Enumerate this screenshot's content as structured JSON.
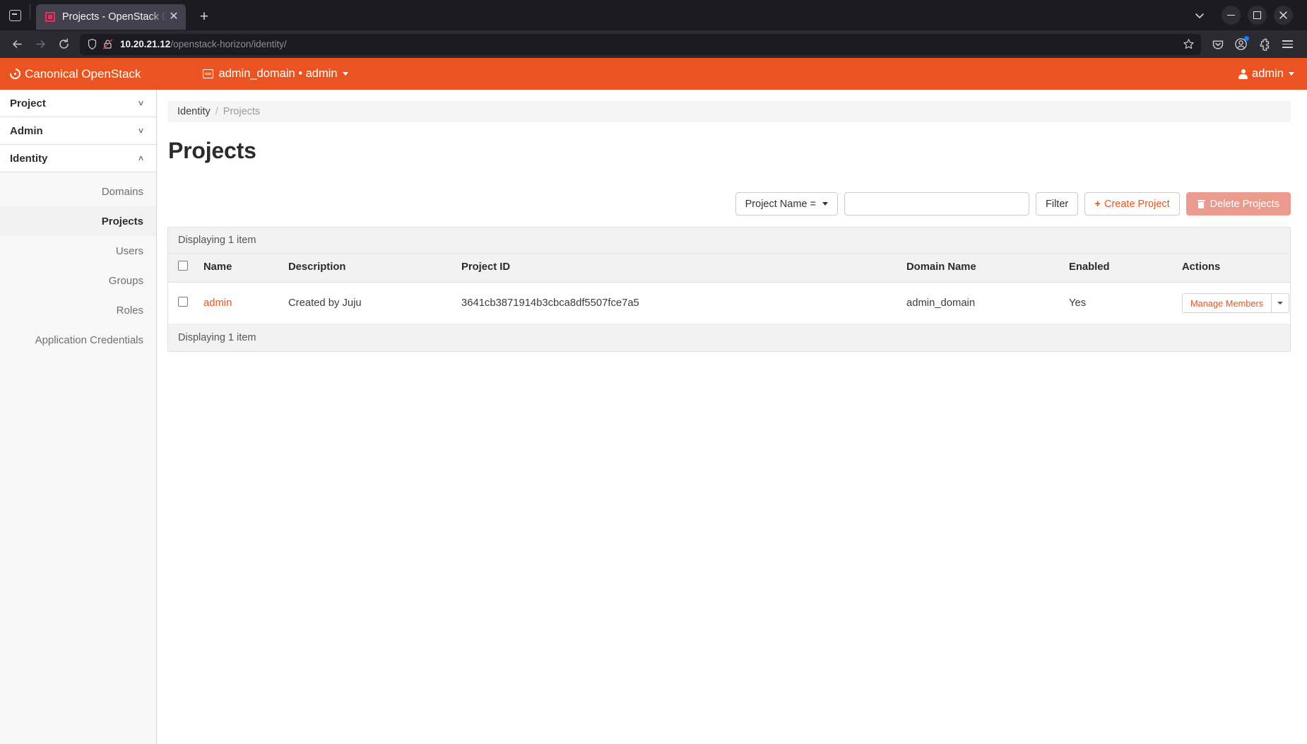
{
  "browser": {
    "firefox_view_label": "firefox-view",
    "tab": {
      "title": "Projects - OpenStack Das",
      "close_label": "✕"
    },
    "newtab_label": "+",
    "window_controls": {
      "chevron": "⌄",
      "minimize": "−",
      "maximize": "❐",
      "close": "✕"
    },
    "nav": {
      "back": "←",
      "forward": "→",
      "reload": "⟳"
    },
    "url": {
      "host": "10.20.21.12",
      "path": "/openstack-horizon/identity/",
      "full": "10.20.21.12/openstack-horizon/identity/",
      "security": "insecure-http"
    },
    "toolbar_icons": [
      "pocket-icon",
      "account-icon",
      "extensions-icon",
      "menu-icon"
    ]
  },
  "header": {
    "brand": "Canonical OpenStack",
    "context_switcher": "admin_domain • admin",
    "user": "admin",
    "accent_color": "#e95420"
  },
  "sidebar": {
    "groups": [
      {
        "label": "Project",
        "expanded": false,
        "chevron": "˅"
      },
      {
        "label": "Admin",
        "expanded": false,
        "chevron": "˅"
      },
      {
        "label": "Identity",
        "expanded": true,
        "chevron": "˄"
      }
    ],
    "items": [
      {
        "label": "Domains",
        "selected": false
      },
      {
        "label": "Projects",
        "selected": true
      },
      {
        "label": "Users",
        "selected": false
      },
      {
        "label": "Groups",
        "selected": false
      },
      {
        "label": "Roles",
        "selected": false
      },
      {
        "label": "Application Credentials",
        "selected": false
      }
    ]
  },
  "breadcrumb": {
    "root": "Identity",
    "separator": "/",
    "current": "Projects"
  },
  "page": {
    "title": "Projects"
  },
  "toolbar": {
    "filter_field_label": "Project Name =",
    "filter_value": "",
    "filter_placeholder": "",
    "filter_button": "Filter",
    "create_button": "Create Project",
    "create_plus": "+",
    "delete_button": "Delete Projects",
    "delete_color": "#eb9a8e"
  },
  "table": {
    "count_top": "Displaying 1 item",
    "count_bottom": "Displaying 1 item",
    "columns": [
      "Name",
      "Description",
      "Project ID",
      "Domain Name",
      "Enabled",
      "Actions"
    ],
    "rows": [
      {
        "checked": false,
        "name": "admin",
        "description": "Created by Juju",
        "project_id": "3641cb3871914b3cbca8df5507fce7a5",
        "domain_name": "admin_domain",
        "enabled": "Yes",
        "action_primary": "Manage Members"
      }
    ]
  }
}
